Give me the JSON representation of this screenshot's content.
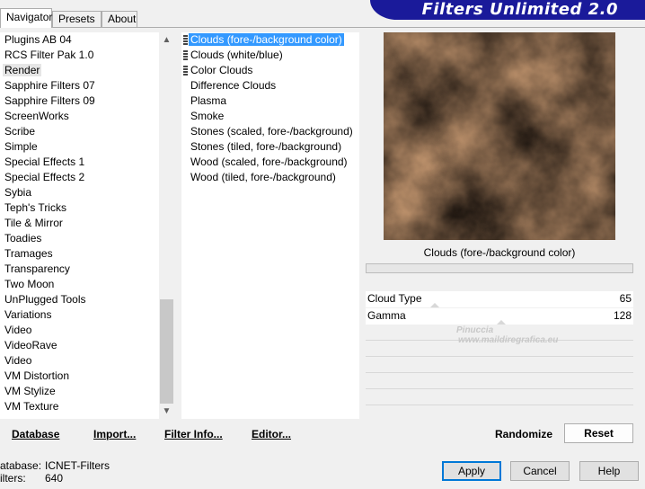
{
  "tabs": [
    "Navigator",
    "Presets",
    "About"
  ],
  "banner": "Filters Unlimited 2.0",
  "categories": [
    "Plugins AB 04",
    "RCS Filter Pak 1.0",
    "Render",
    "Sapphire Filters 07",
    "Sapphire Filters 09",
    "ScreenWorks",
    "Scribe",
    "Simple",
    "Special Effects 1",
    "Special Effects 2",
    "Sybia",
    "Teph's Tricks",
    "Tile & Mirror",
    "Toadies",
    "Tramages",
    "Transparency",
    "Two Moon",
    "UnPlugged Tools",
    "Variations",
    "Video",
    "VideoRave",
    "Video",
    "VM Distortion",
    "VM Stylize",
    "VM Texture"
  ],
  "selected_category": "Render",
  "filters": [
    "Clouds (fore-/background color)",
    "Clouds (white/blue)",
    "Color Clouds",
    "Difference Clouds",
    "Plasma",
    "Smoke",
    "Stones (scaled, fore-/background)",
    "Stones (tiled, fore-/background)",
    "Wood (scaled, fore-/background)",
    "Wood (tiled, fore-/background)"
  ],
  "selected_filter": "Clouds (fore-/background color)",
  "filter_title": "Clouds (fore-/background color)",
  "params": [
    {
      "label": "Cloud Type",
      "value": "65"
    },
    {
      "label": "Gamma",
      "value": "128"
    }
  ],
  "watermark": {
    "line1": "Pinuccia",
    "line2": "www.maildiregrafica.eu"
  },
  "bottom_links": [
    "Database",
    "Import...",
    "Filter Info...",
    "Editor..."
  ],
  "randomize": "Randomize",
  "reset": "Reset",
  "database_label": "atabase:",
  "database_value": "ICNET-Filters",
  "filters_label": "ilters:",
  "filters_value": "640",
  "apply": "Apply",
  "cancel": "Cancel",
  "help": "Help",
  "colors": {
    "selection": "#3399ff",
    "banner": "#1a1a9a",
    "preview_light": "#c89a72",
    "preview_dark": "#1e1610"
  }
}
